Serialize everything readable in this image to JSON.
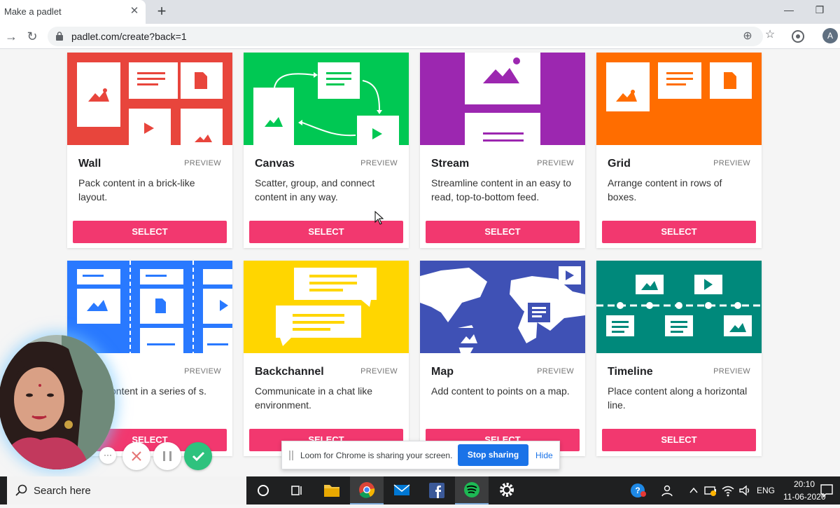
{
  "browser": {
    "tab_title": "Make a padlet",
    "tab_close": "✕",
    "new_tab": "+",
    "url": "padlet.com/create?back=1",
    "avatar_letter": "A",
    "minimize": "—",
    "maximize": "❐"
  },
  "cards": [
    {
      "title": "Wall",
      "preview": "PREVIEW",
      "desc": "Pack content in a brick-like layout.",
      "select": "SELECT",
      "color": "#e8453c"
    },
    {
      "title": "Canvas",
      "preview": "PREVIEW",
      "desc": "Scatter, group, and connect content in any way.",
      "select": "SELECT",
      "color": "#00c853"
    },
    {
      "title": "Stream",
      "preview": "PREVIEW",
      "desc": "Streamline content in an easy to read, top-to-bottom feed.",
      "select": "SELECT",
      "color": "#9c27b0"
    },
    {
      "title": "Grid",
      "preview": "PREVIEW",
      "desc": "Arrange content in rows of boxes.",
      "select": "SELECT",
      "color": "#ff6d00"
    },
    {
      "title": "",
      "preview": "PREVIEW",
      "desc": "ontent in a series of s.",
      "select": "SELECT",
      "color": "#2979ff"
    },
    {
      "title": "Backchannel",
      "preview": "PREVIEW",
      "desc": "Communicate in a chat like environment.",
      "select": "SELECT",
      "color": "#ffd600"
    },
    {
      "title": "Map",
      "preview": "PREVIEW",
      "desc": "Add content to points on a map.",
      "select": "SELECT",
      "color": "#3f51b5"
    },
    {
      "title": "Timeline",
      "preview": "PREVIEW",
      "desc": "Place content along a horizontal line.",
      "select": "SELECT",
      "color": "#00897b"
    }
  ],
  "loom": {
    "sharing_text": "Loom for Chrome is sharing your screen.",
    "stop_sharing": "Stop sharing",
    "hide": "Hide",
    "more": "···"
  },
  "taskbar": {
    "search_placeholder": "Search here",
    "language": "ENG",
    "time": "20:10",
    "date": "11-06-2020"
  },
  "colors": {
    "select_button": "#f2386f",
    "stop_sharing": "#1a73e8"
  }
}
